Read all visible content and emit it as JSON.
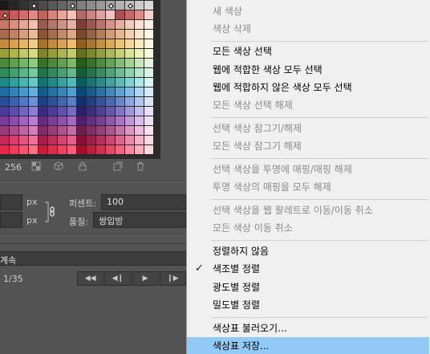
{
  "swatches": {
    "colors": [
      "#1a1a1a",
      "#262626",
      "#333333",
      "#3f3f3f",
      "#4c4c4c",
      "#595959",
      "#666666",
      "#737373",
      "#808080",
      "#8c8c8c",
      "#999999",
      "#a6a6a6",
      "#b2b2b2",
      "#bfbfbf",
      "#cccccc",
      "#d9d9d9",
      "#b94a48",
      "#c85a5a",
      "#d46e6e",
      "#e08a8a",
      "#c0655b",
      "#d8847a",
      "#e9a69c",
      "#f2c3bd",
      "#b36a6a",
      "#cc8585",
      "#e0a3a3",
      "#f0c4c4",
      "#a85050",
      "#c46a6a",
      "#dd8c8c",
      "#f5d2d2",
      "#c8786a",
      "#d9907f",
      "#e7a897",
      "#f1c1b2",
      "#9b5c52",
      "#b4776c",
      "#cd9489",
      "#e4b3a8",
      "#7d3f38",
      "#9a5a52",
      "#b8776e",
      "#d6968d",
      "#e6b0a2",
      "#f3cbbf",
      "#fbe2d8",
      "#fff1ea",
      "#a66b4e",
      "#bf8466",
      "#d59f80",
      "#e8bb9d",
      "#8c5438",
      "#a66e50",
      "#c18a6c",
      "#dba78a",
      "#7a4a30",
      "#966446",
      "#b3805f",
      "#cf9d7c",
      "#e2b896",
      "#f0d2b3",
      "#f9e6cf",
      "#fff6e6",
      "#c58b3a",
      "#d6a04e",
      "#e4b766",
      "#efcd82",
      "#a97529",
      "#c18c3b",
      "#d7a452",
      "#ebbd6c",
      "#8f5f1c",
      "#a9772d",
      "#c29043",
      "#d9aa5c",
      "#e9c47a",
      "#f3d99a",
      "#faeabd",
      "#fff7de",
      "#9aa03a",
      "#b0b54e",
      "#c4c866",
      "#d7da82",
      "#7f8629",
      "#979d3b",
      "#aeb451",
      "#c5ca6b",
      "#66701c",
      "#7d872c",
      "#959f42",
      "#adb75b",
      "#c6cf79",
      "#dbe29a",
      "#ecf1bd",
      "#f8fbe0",
      "#4a8a3a",
      "#5ea04e",
      "#75b566",
      "#90c982",
      "#387329",
      "#4c893b",
      "#63a051",
      "#7eb86b",
      "#275d1c",
      "#3a722c",
      "#4f8942",
      "#67a25b",
      "#86bb79",
      "#a6d29a",
      "#c7e6bd",
      "#e4f5de",
      "#2f8a5a",
      "#42a06e",
      "#59b585",
      "#76c99e",
      "#217349",
      "#33895d",
      "#49a073",
      "#63b88c",
      "#155d39",
      "#26734c",
      "#3a8962",
      "#52a27a",
      "#70bb95",
      "#92d2b1",
      "#b8e6cf",
      "#dcf5e9",
      "#1f8a8a",
      "#33a0a0",
      "#4ab5b5",
      "#68c9c9",
      "#137373",
      "#258989",
      "#3aa0a0",
      "#54b8b8",
      "#0a5d5d",
      "#1a7373",
      "#2e8989",
      "#45a2a2",
      "#62bbbb",
      "#85d2d2",
      "#aee6e6",
      "#d6f5f5",
      "#1f6fa6",
      "#3383b9",
      "#4a98cb",
      "#67addc",
      "#155c8c",
      "#2670a2",
      "#3a85b8",
      "#549cce",
      "#0b4872",
      "#1b5c88",
      "#2e709e",
      "#4587b5",
      "#62a1cc",
      "#86bbe0",
      "#aed4f0",
      "#d6eafa",
      "#2a4f9a",
      "#3c63ae",
      "#5278c1",
      "#6d90d3",
      "#1f3f82",
      "#2f5297",
      "#4366ac",
      "#5c7fc2",
      "#142f6a",
      "#22407e",
      "#345493",
      "#4b6baa",
      "#6987c2",
      "#8ca6d8",
      "#b3c6ec",
      "#dae5fa",
      "#4a3a9a",
      "#5d4dae",
      "#7264c1",
      "#8b7ed3",
      "#3a2c82",
      "#4c3e97",
      "#6052ac",
      "#786bc2",
      "#2b1f6a",
      "#3c2f7e",
      "#4f4293",
      "#6659aa",
      "#8275c2",
      "#a298d8",
      "#c5bdec",
      "#e5e1fa",
      "#7a3a9a",
      "#8e4dae",
      "#a364c1",
      "#b97ed3",
      "#652c82",
      "#793e97",
      "#8e52ac",
      "#a56bc2",
      "#4f1f6a",
      "#632f7e",
      "#784293",
      "#8f59aa",
      "#a975c2",
      "#c398d8",
      "#dcbdec",
      "#f0e1fa",
      "#9a3a7a",
      "#ae4d8e",
      "#c164a3",
      "#d37eb9",
      "#822c65",
      "#973e79",
      "#ac528e",
      "#c26ba5",
      "#6a1f4f",
      "#7e2f63",
      "#934278",
      "#aa598f",
      "#c275a9",
      "#d898c3",
      "#ecbddc",
      "#fae1f0",
      "#c8285a",
      "#d83c6e",
      "#e55584",
      "#ef729c",
      "#a81c4a",
      "#bd2e5d",
      "#d24472",
      "#e35e89",
      "#870f38",
      "#9c1f4a",
      "#b2325e",
      "#c84a74",
      "#dc668e",
      "#ea8aab",
      "#f4b0c7",
      "#fbd8e4",
      "#e8284a",
      "#f03c5c",
      "#f55570",
      "#f87288",
      "#c81c3c",
      "#dc2e4e",
      "#ea4462",
      "#f25e78",
      "#a50f2c",
      "#ba1f3c",
      "#cf3250",
      "#e24a66",
      "#ef6680",
      "#f68a9e",
      "#f9b0be",
      "#fcd8df"
    ],
    "marked_indices": [
      3,
      7,
      11,
      13,
      16
    ],
    "color_count": "256"
  },
  "footer_icons": [
    "web-snap-icon",
    "cube-icon",
    "lock-icon",
    "new-swatch-icon",
    "trash-icon"
  ],
  "image_size": {
    "unit_px_1": "px",
    "unit_px_2": "px",
    "percent_label": "퍼센트:",
    "percent_value": "100",
    "quality_label": "품질:",
    "quality_value": "쌍입방"
  },
  "animation": {
    "loop_label": "계속",
    "frame_counter": "1/35",
    "buttons": [
      "◀◀",
      "◀❙",
      "▶",
      "❙▶"
    ]
  },
  "menu": {
    "items": [
      {
        "label": "새 색상",
        "disabled": true
      },
      {
        "label": "색상 삭제",
        "disabled": true
      },
      {
        "label": "모든 색상 선택",
        "disabled": false
      },
      {
        "label": "웹에 적합한 색상 모두 선택",
        "disabled": false
      },
      {
        "label": "웹에 적합하지 않은 색상 모두 선택",
        "disabled": false
      },
      {
        "label": "모든 색상 선택 해제",
        "disabled": true
      },
      {
        "label": "선택 색상 잠그기/해제",
        "disabled": true
      },
      {
        "label": "모든 색상 잠그기 해제",
        "disabled": true
      },
      {
        "label": "선택 색상을 투명에 매핑/매핑 해제",
        "disabled": true
      },
      {
        "label": "투명 색상의 매핑을 모두 해제",
        "disabled": true
      },
      {
        "label": "선택 색상을 웹 팔레트로 이동/이동 취소",
        "disabled": true
      },
      {
        "label": "모든 색상 이동 취소",
        "disabled": true
      },
      {
        "label": "정렬하지 않음",
        "disabled": false
      },
      {
        "label": "색조별 정렬",
        "disabled": false,
        "checked": true
      },
      {
        "label": "광도별 정렬",
        "disabled": false
      },
      {
        "label": "밀도별 정렬",
        "disabled": false
      },
      {
        "label": "색상표 불러오기...",
        "disabled": false
      },
      {
        "label": "색상표 저장...",
        "disabled": false,
        "highlighted": true
      }
    ]
  }
}
